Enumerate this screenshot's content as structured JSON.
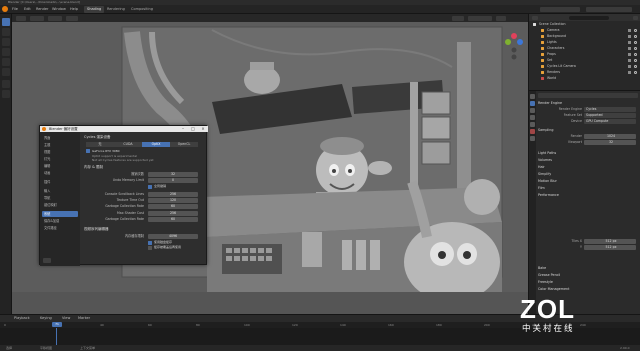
{
  "window": {
    "title": "Blender [C:\\Users\\...\\Downloads\\...\\scene.blend]"
  },
  "menubar": {
    "items": [
      "File",
      "Edit",
      "Render",
      "Window",
      "Help"
    ],
    "workspaces": [
      "Layout",
      "Modeling",
      "Sculpting",
      "UV Editing",
      "Texture Paint",
      "Shading",
      "Animation",
      "Rendering",
      "Compositing"
    ],
    "active_workspace": "Shading",
    "visible_tabs": [
      "Shading",
      "Rendering",
      "Compositing"
    ]
  },
  "dialog": {
    "title": "Blender 偏好设置",
    "sidebar": [
      "界面",
      "主题",
      "视图",
      "灯光",
      "编辑",
      "动画",
      "插件",
      "输入",
      "导航",
      "键位映射",
      "系统",
      "保存&加载",
      "文件路径"
    ],
    "active_sidebar": "系统",
    "cycles_header": "Cycles 渲染设备",
    "device_tabs": [
      "无",
      "CUDA",
      "OptiX",
      "OpenCL"
    ],
    "active_device_tab": "OptiX",
    "gpu_name": "GeForce RTX 3080",
    "gpu_note_1": "OptiX support is experimental",
    "gpu_note_2": "Not all Cycles features are supported yet",
    "memory_header": "内存 & 限制",
    "memory_rows": [
      {
        "label": "撤销次数",
        "value": "32"
      },
      {
        "label": "Undo Memory Limit",
        "value": "0"
      },
      {
        "label": "",
        "value": "全局撤销",
        "type": "check"
      },
      {
        "label": "Console Scrollback Lines",
        "value": "256"
      },
      {
        "label": "Texture Time Out",
        "value": "120"
      },
      {
        "label": "Garbage Collection Rate",
        "value": "60"
      },
      {
        "label": "Max Shader Cost",
        "value": "256"
      },
      {
        "label": "Garbage Collection Rate",
        "value": "60"
      }
    ],
    "video_header": "视频序列编辑器",
    "video_rows": [
      {
        "label": "内存缓存限制",
        "value": "4096"
      },
      {
        "label": "",
        "value": "使用磁盘缓存",
        "type": "check"
      },
      {
        "label": "",
        "value": "缓存被覆盖后再使用",
        "type": "check"
      }
    ]
  },
  "outliner": {
    "header": "Scene Collection",
    "rows": [
      {
        "name": "Scene Collection",
        "indent": 0
      },
      {
        "name": "Camera",
        "indent": 1
      },
      {
        "name": "Background",
        "indent": 1
      },
      {
        "name": "Lights",
        "indent": 1
      },
      {
        "name": "Characters",
        "indent": 1
      },
      {
        "name": "Props",
        "indent": 1
      },
      {
        "name": "Set",
        "indent": 1
      },
      {
        "name": "Cycles Lit Camera",
        "indent": 1
      },
      {
        "name": "Renders",
        "indent": 1
      },
      {
        "name": "World",
        "indent": 1
      }
    ]
  },
  "properties": {
    "section_render": "Render Engine",
    "rows": [
      {
        "label": "Render Engine",
        "value": "Cycles"
      },
      {
        "label": "Feature Set",
        "value": "Supported"
      },
      {
        "label": "Device",
        "value": "GPU Compute"
      }
    ],
    "sampling": "Sampling",
    "sample_rows": [
      {
        "label": "Render",
        "value": "1024"
      },
      {
        "label": "Viewport",
        "value": "32"
      }
    ],
    "sections": [
      "Light Paths",
      "Volumes",
      "Hair",
      "Simplify",
      "Motion Blur",
      "Film",
      "Performance",
      "Bake",
      "Grease Pencil",
      "Freestyle",
      "Color Management"
    ],
    "tile_rows": [
      {
        "label": "Tiles X",
        "value": "512 px"
      },
      {
        "label": "Y",
        "value": "512 px"
      }
    ],
    "frame_label": "Start Frame",
    "frame_value": "1"
  },
  "timeline": {
    "header": [
      "Playback",
      "Keying",
      "View",
      "Marker"
    ],
    "ticks": [
      "0",
      "20",
      "40",
      "60",
      "80",
      "100",
      "120",
      "140",
      "160",
      "180",
      "200",
      "220",
      "240"
    ],
    "current_frame": "71",
    "status_left": "选择",
    "status_mid": "平移视图",
    "status_right": "上下文菜单",
    "version": "2.90.0"
  },
  "watermark": {
    "logo": "ZOL",
    "sub": "中关村在线"
  },
  "colors": {
    "accent": "#4772b3",
    "panel": "#2b2b2b",
    "viewport": "#5a5a5a"
  }
}
